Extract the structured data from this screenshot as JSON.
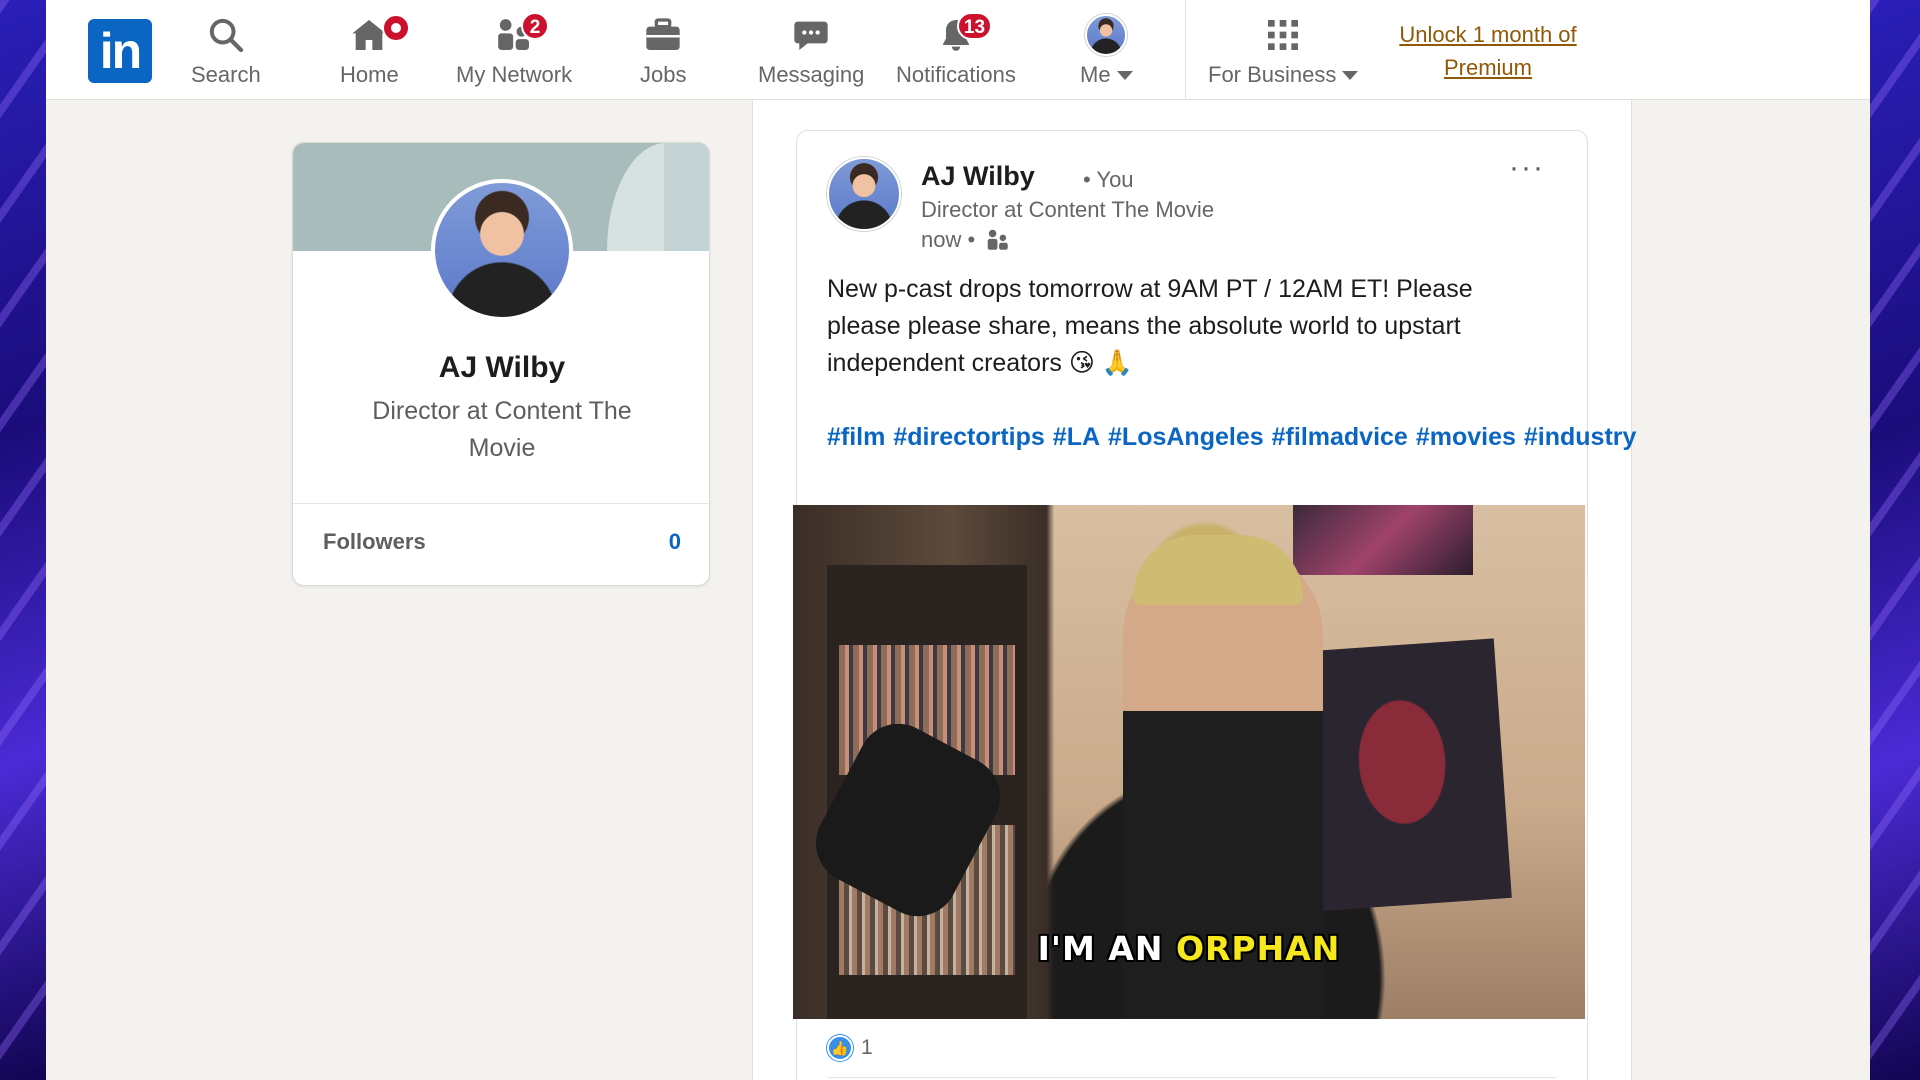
{
  "nav": {
    "search": "Search",
    "home": "Home",
    "network": "My Network",
    "network_badge": "2",
    "jobs": "Jobs",
    "messaging": "Messaging",
    "notifications": "Notifications",
    "notifications_badge": "13",
    "me": "Me",
    "for_business": "For Business",
    "premium": "Unlock 1 month of Premium"
  },
  "profile": {
    "name": "AJ Wilby",
    "headline": "Director at Content The Movie",
    "followers_label": "Followers",
    "followers_count": "0"
  },
  "post": {
    "author": "AJ Wilby",
    "you": "• You",
    "headline": "Director at Content The Movie",
    "time": "now •",
    "more": "···",
    "text": "New p-cast drops tomorrow at 9AM PT / 12AM ET! Please please please share, means the absolute world to upstart independent creators 😘 🙏",
    "hashtags": [
      "#film",
      "#directortips",
      "#LA",
      "#LosAngeles",
      "#filmadvice",
      "#movies",
      "#industry"
    ],
    "caption_a": "I'M AN",
    "caption_b": "ORPHAN",
    "reaction_count": "1"
  },
  "colors": {
    "brand": "#0a66c2",
    "badge": "#cb112d",
    "premium": "#915907",
    "caption_highlight": "#f7e81e"
  }
}
